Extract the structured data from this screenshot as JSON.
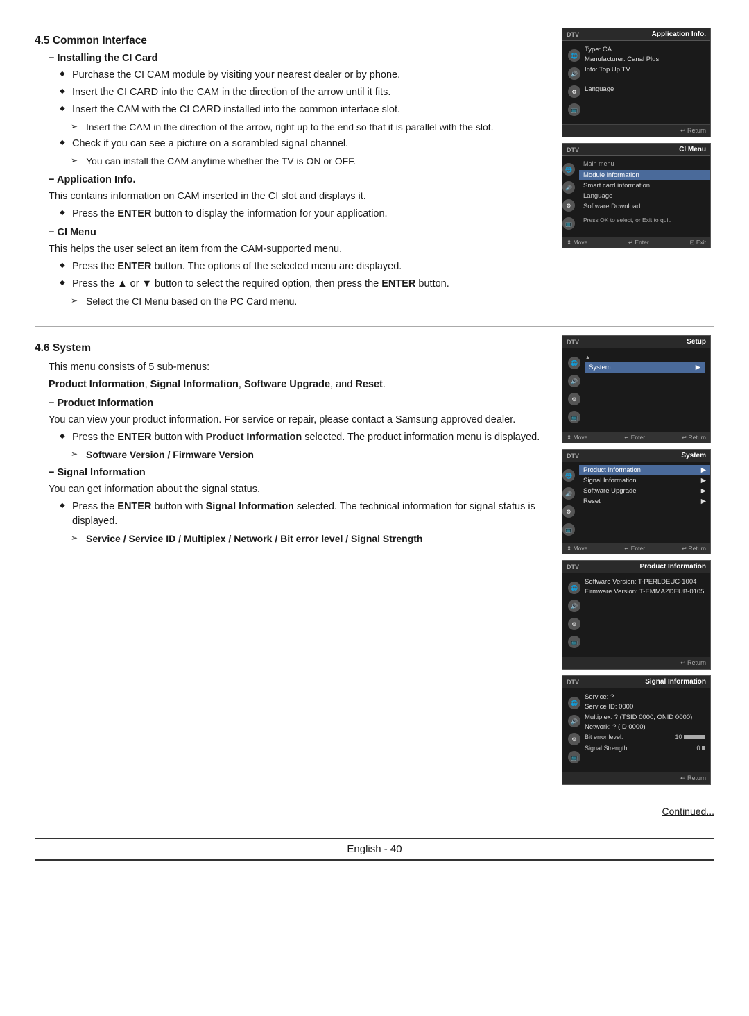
{
  "page": {
    "bottom_label": "English - 40",
    "continued_text": "Continued..."
  },
  "section_45": {
    "heading": "4.5 Common Interface",
    "sub_installing": "Installing the CI Card",
    "bullets_installing": [
      "Purchase the CI CAM module by visiting your nearest dealer or by phone.",
      "Insert the CI CARD into the CAM in the direction of the arrow until it fits.",
      "Insert the CAM with the CI CARD installed into the common interface slot."
    ],
    "arrows_installing": [
      "Insert the CAM in the direction of the arrow, right up to the end so that it is parallel with the slot."
    ],
    "bullets_installing2": [
      "Check if you can see a picture on a scrambled signal channel."
    ],
    "arrows_installing2": [
      "You can install the CAM anytime whether the TV is ON or OFF."
    ],
    "sub_appinfo": "Application Info.",
    "appinfo_text": "This contains information on CAM inserted in the CI slot and displays it.",
    "bullets_appinfo": [
      "Press the ENTER button to display the information for your application."
    ],
    "sub_cimenu": "CI Menu",
    "cimenu_text": "This helps the user select an item from the CAM-supported menu.",
    "bullets_cimenu": [
      "Press the ENTER button. The options of the selected menu are displayed.",
      "Press the ▲ or ▼ button to select the required option, then press the ENTER button."
    ],
    "arrows_cimenu": [
      "Select the CI Menu based on the PC Card menu."
    ],
    "screen_appinfo": {
      "dtv": "DTV",
      "title": "Application Info.",
      "type_label": "Type: CA",
      "manufacturer": "Manufacturer: Canal Plus",
      "info": "Info: Top Up TV",
      "language_label": "Language",
      "return_label": "↩ Return"
    },
    "screen_cimenu": {
      "dtv": "DTV",
      "title": "CI Menu",
      "main_menu_label": "Main menu",
      "menu_items": [
        "Module information",
        "Smart card information",
        "Language",
        "Software Download"
      ],
      "highlighted_index": 0,
      "prompt": "Press OK to select, or Exit to quit.",
      "nav_move": "⇕ Move",
      "nav_enter": "↵ Enter",
      "nav_exit": "⊡ Exit"
    }
  },
  "section_46": {
    "heading": "4.6 System",
    "intro": "This menu consists of 5 sub-menus:",
    "sub_menu_bold": "Product Information, Signal Information, Software Upgrade, and Reset.",
    "sub_product": "Product Information",
    "product_text": "You can view your product information. For service or repair, please contact a Samsung approved dealer.",
    "bullets_product": [
      "Press the ENTER button with Product Information selected. The product information menu is displayed."
    ],
    "arrows_product": [
      "Software Version / Firmware Version"
    ],
    "sub_signal": "Signal Information",
    "signal_text": "You can get information about the signal status.",
    "bullets_signal": [
      "Press the ENTER button with Signal Information selected. The technical information for signal status is displayed."
    ],
    "arrows_signal": [
      "Service / Service ID / Multiplex / Network / Bit error level / Signal Strength"
    ],
    "screen_setup": {
      "dtv": "DTV",
      "title": "Setup",
      "arrow_up": "▲",
      "system_label": "System",
      "nav_move": "⇕ Move",
      "nav_enter": "↵ Enter",
      "nav_return": "↩ Return"
    },
    "screen_system": {
      "dtv": "DTV",
      "title": "System",
      "menu_items": [
        "Product Information",
        "Signal Information",
        "Software Upgrade",
        "Reset"
      ],
      "nav_move": "⇕ Move",
      "nav_enter": "↵ Enter",
      "nav_return": "↩ Return"
    },
    "screen_productinfo": {
      "dtv": "DTV",
      "title": "Product Information",
      "software_version": "Software Version: T-PERLDEUC-1004",
      "firmware_version": "Firmware Version: T-EMMAZDEUB-0105",
      "return_label": "↩ Return"
    },
    "screen_signalinfo": {
      "dtv": "DTV",
      "title": "Signal Information",
      "service": "Service: ?",
      "service_id": "Service ID: 0000",
      "multiplex": "Multiplex: ? (TSID 0000, ONID 0000)",
      "network": "Network: ? (ID 0000)",
      "bit_error_label": "Bit error level:",
      "bit_error_value": "10",
      "signal_strength_label": "Signal Strength:",
      "signal_strength_value": "0",
      "return_label": "↩ Return"
    }
  }
}
